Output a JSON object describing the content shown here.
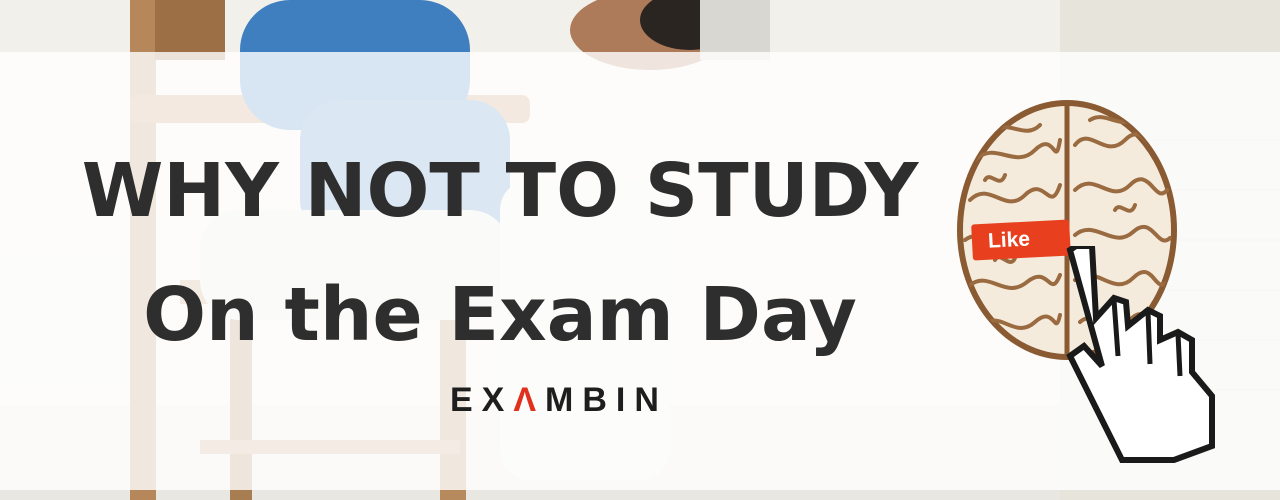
{
  "headline": {
    "line1": "WHY NOT TO STUDY",
    "line2": "On the Exam Day"
  },
  "logo": {
    "prefix": "EX",
    "accent_letter": "Λ",
    "suffix": "MBIN"
  },
  "brain_tag": {
    "label": "Like"
  },
  "colors": {
    "text": "#2e2e2e",
    "brand_accent": "#e0311e",
    "like_tag": "#e8401f",
    "sweater": "#3f7fc0"
  },
  "icons": [
    "brain-icon",
    "pointer-hand-cursor-icon"
  ]
}
